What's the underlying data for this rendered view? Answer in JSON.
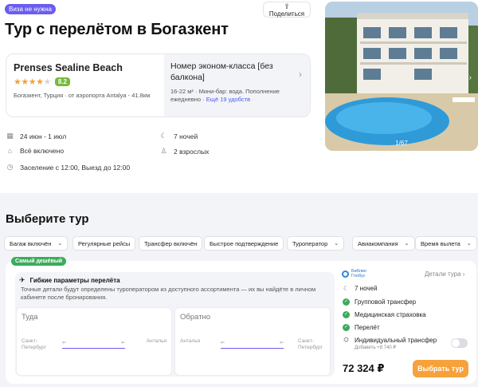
{
  "header": {
    "visa_badge": "Виза не нужна",
    "share_label": "Поделиться",
    "title": "Тур с перелётом в Богазкент"
  },
  "hotel": {
    "name": "Prenses Sealine Beach",
    "stars": 4,
    "stars_max": 5,
    "score": "8.2",
    "location": "Богазкент, Турция · от аэропорта Antalya - 41.8км"
  },
  "room": {
    "title": "Номер эконом-класса [без балкона]",
    "info": "16-22 м² · Мини-бар: вода. Пополнение ежедневно · ",
    "more_link": "Ещё 19 удобств"
  },
  "details": {
    "dates": "24 июн - 1 июл",
    "nights": "7 ночей",
    "meal": "Всё включено",
    "guests": "2 взрослых",
    "checkin": "Заселение с 12:00, Выезд до 12:00"
  },
  "photo": {
    "counter": "1/67"
  },
  "tours": {
    "section_title": "Выберите тур",
    "filters": [
      {
        "label": "Багаж включён",
        "dropdown": true
      },
      {
        "label": "Регулярные рейсы",
        "dropdown": false
      },
      {
        "label": "Трансфер включён",
        "dropdown": false
      },
      {
        "label": "Быстрое подтверждение",
        "dropdown": false
      },
      {
        "label": "Туроператор",
        "dropdown": true
      },
      {
        "label": "Авиакомпания",
        "dropdown": true
      },
      {
        "label": "Время вылета",
        "dropdown": true
      }
    ],
    "card": {
      "badge": "Самый дешёвый",
      "flex_title": "Гибкие параметры перелёта",
      "flex_desc": "Точные детали будут определены туроператором из доступного ассортимента — их вы найдёте в личном кабинете после бронирования.",
      "outbound": {
        "title": "Туда",
        "from": "Санкт-Петербург",
        "to": "Анталья",
        "dep_icon": "⇐",
        "arr_icon": "⇐"
      },
      "return": {
        "title": "Обратно",
        "from": "Анталья",
        "to": "Санкт-Петербург",
        "dep_icon": "⇐",
        "arr_icon": "⇐"
      },
      "operator_logo": "Библио Глобус",
      "tour_details_link": "Детали тура",
      "nights": "7 ночей",
      "inclusions": [
        "Групповой трансфер",
        "Медицинская страховка",
        "Перелёт"
      ],
      "individual_transfer": "Индивидуальный трансфер",
      "individual_transfer_price": "Добавить +8 740 ₽",
      "individual_transfer_on": false,
      "price": "72 324 ₽",
      "choose_button": "Выбрать тур"
    }
  },
  "colors": {
    "accent_purple": "#6b5cf0",
    "green": "#3cab5c",
    "orange": "#f6a23c",
    "star": "#f2a23a"
  }
}
